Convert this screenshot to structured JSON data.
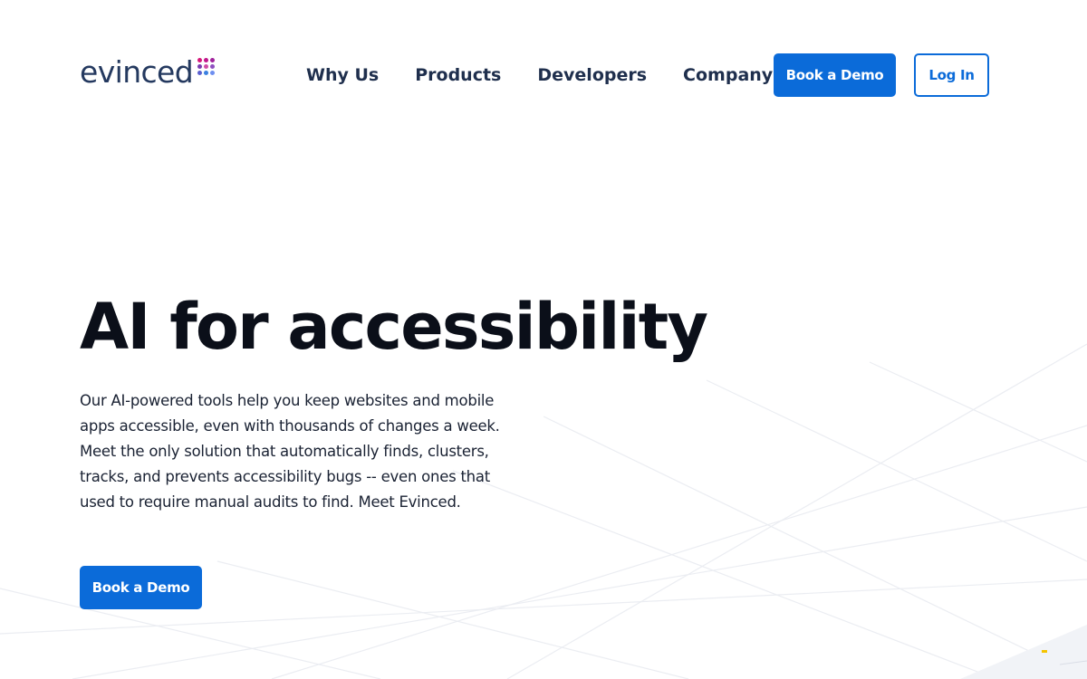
{
  "brand": {
    "logo_text": "evinced",
    "accent_color": "#0b6bd9",
    "logo_dots": [
      "#d6177a",
      "#c0168b",
      "#a0229c",
      "#7b3bb0",
      "#d14da6",
      "#8f4fc0",
      "#5a5fd0",
      "#3b80e0",
      "#6e8ff0"
    ]
  },
  "nav": {
    "items": [
      "Why Us",
      "Products",
      "Developers",
      "Company"
    ],
    "book_demo_label": "Book a Demo",
    "login_label": "Log In"
  },
  "hero": {
    "title": "AI for accessibility",
    "description": "Our AI-powered tools help you keep websites and mobile apps accessible, even with thousands of changes a week. Meet the only solution that automatically finds, clusters, tracks, and prevents accessibility bugs -- even ones that used to require manual audits to find. Meet Evinced.",
    "cta_label": "Book a Demo"
  }
}
